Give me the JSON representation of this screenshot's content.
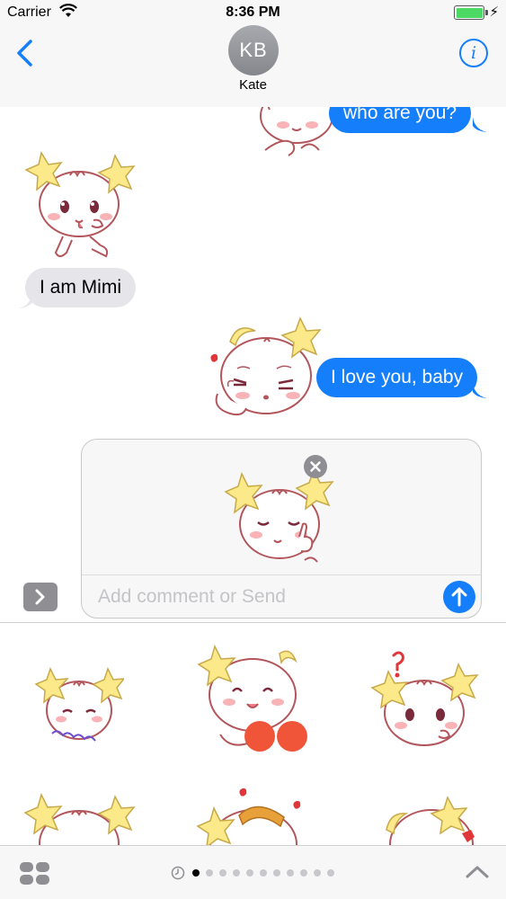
{
  "status_bar": {
    "carrier": "Carrier",
    "time": "8:36 PM",
    "battery_level": 1.0,
    "charging": "⚡"
  },
  "header": {
    "contact_initials": "KB",
    "contact_name": "Kate",
    "info_label": "i"
  },
  "messages": [
    {
      "direction": "outgoing",
      "text": "who are you?",
      "sticker": "mimi-cat-peek"
    },
    {
      "direction": "incoming",
      "text": "I am Mimi",
      "sticker": "mimi-cat-wave"
    },
    {
      "direction": "outgoing",
      "text": "I love you, baby",
      "sticker": "mimi-cat-kiss"
    }
  ],
  "compose": {
    "staged_sticker": "mimi-cat-wink",
    "placeholder": "Add comment or Send"
  },
  "sticker_drawer": {
    "stickers": [
      "mimi-cat-shy",
      "mimi-cat-cheer",
      "mimi-cat-question",
      "mimi-cat-star",
      "mimi-cat-hearts",
      "mimi-cat-peek-2"
    ]
  },
  "page_indicator": {
    "total": 11,
    "active": 1
  },
  "colors": {
    "accent": "#147efb",
    "incoming_bubble": "#e6e6ea",
    "star": "#fbe98a",
    "outline": "#b2565c",
    "blush": "#f9b3b6"
  }
}
